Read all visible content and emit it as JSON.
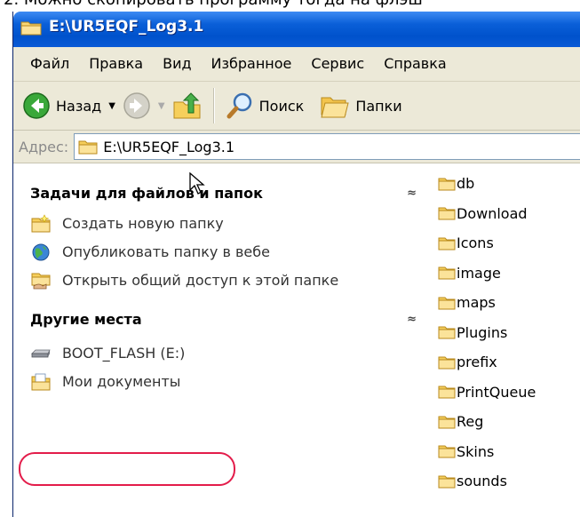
{
  "caption": "2. Можно скопировать программу тогда на флэш",
  "window": {
    "title": "E:\\UR5EQF_Log3.1"
  },
  "menu": {
    "items": [
      "Файл",
      "Правка",
      "Вид",
      "Избранное",
      "Сервис",
      "Справка"
    ]
  },
  "toolbar": {
    "back_label": "Назад",
    "search_label": "Поиск",
    "folders_label": "Папки"
  },
  "address": {
    "label": "Адрес:",
    "value": "E:\\UR5EQF_Log3.1"
  },
  "tasks_panel": {
    "title": "Задачи для файлов и папок",
    "items": [
      {
        "label": "Создать новую папку",
        "icon": "new-folder-icon"
      },
      {
        "label": "Опубликовать папку в вебе",
        "icon": "web-publish-icon"
      },
      {
        "label": "Открыть общий доступ к этой папке",
        "icon": "share-folder-icon"
      }
    ]
  },
  "places_panel": {
    "title": "Другие места",
    "items": [
      {
        "label": "BOOT_FLASH (E:)",
        "icon": "drive-icon"
      },
      {
        "label": "Мои документы",
        "icon": "my-documents-icon"
      }
    ]
  },
  "files": [
    "db",
    "Download",
    "Icons",
    "image",
    "maps",
    "Plugins",
    "prefix",
    "PrintQueue",
    "Reg",
    "Skins",
    "sounds"
  ],
  "colors": {
    "titlebar": "#0052cc",
    "chrome": "#ece9d8",
    "highlight": "#e31c4a"
  }
}
